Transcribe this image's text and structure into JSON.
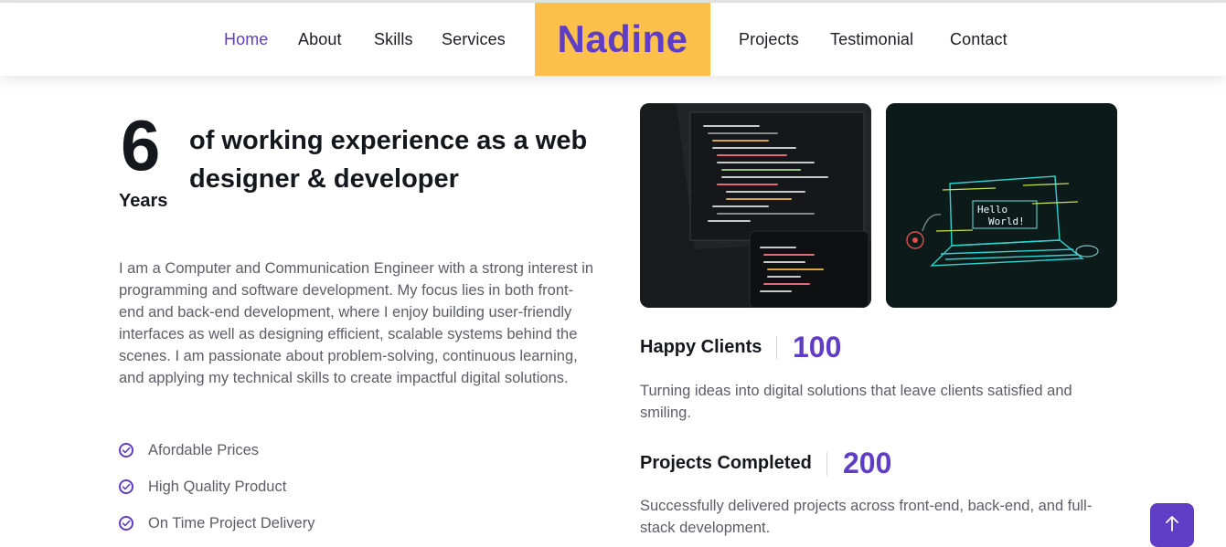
{
  "nav": {
    "brand": "Nadine",
    "links_left": [
      "Home",
      "About",
      "Skills",
      "Services"
    ],
    "links_right": [
      "Projects",
      "Testimonial",
      "Contact"
    ],
    "active": "Home"
  },
  "hero": {
    "years_number": "6",
    "years_label": "Years",
    "headline": "of working experience as a web designer & developer",
    "paragraph": "I am a Computer and Communication Engineer with a strong interest in programming and software development. My focus lies in both front-end and back-end development, where I enjoy building user-friendly interfaces as well as designing efficient, scalable systems behind the scenes. I am passionate about problem-solving, continuous learning, and applying my technical skills to create impactful digital solutions.",
    "features": [
      "Afordable Prices",
      "High Quality Product",
      "On Time Project Delivery"
    ]
  },
  "images": {
    "code_alt": "code-editor-image",
    "hello_alt": "hello-world-laptop-image"
  },
  "stats": [
    {
      "title": "Happy Clients",
      "value": "100",
      "desc": "Turning ideas into digital solutions that leave clients satisfied and smiling."
    },
    {
      "title": "Projects Completed",
      "value": "200",
      "desc": "Successfully delivered projects across front-end, back-end, and full-stack development."
    }
  ],
  "colors": {
    "accent": "#5f3dc4",
    "brand_bg": "#fdc04a",
    "text_dark": "#16161d",
    "text_muted": "#5d5d66"
  },
  "icons": {
    "feature_icon": "check-circle-icon",
    "scroll_top_icon": "arrow-up-icon"
  }
}
